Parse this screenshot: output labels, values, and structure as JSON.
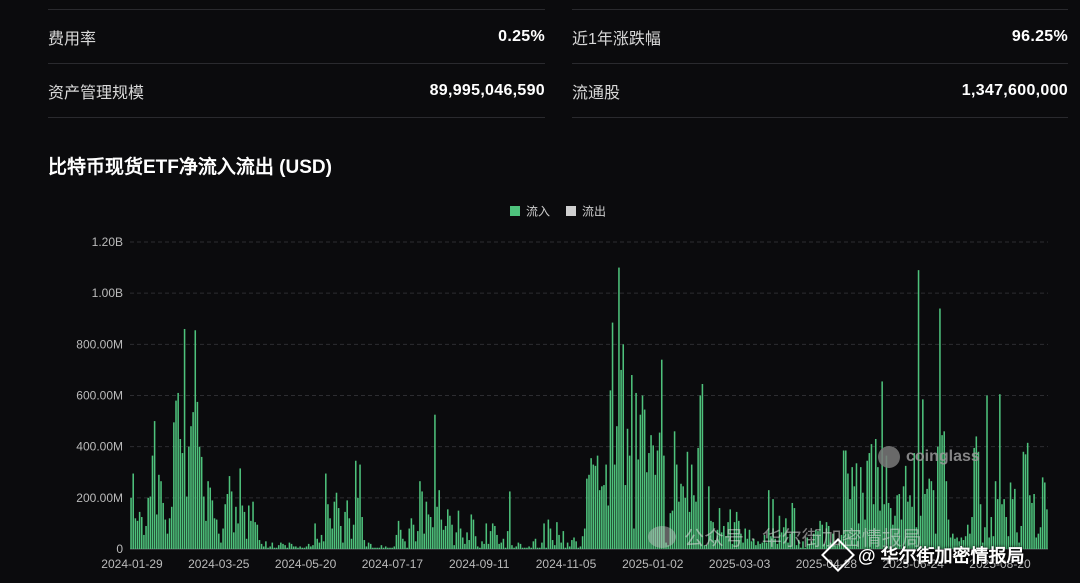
{
  "stats": [
    [
      {
        "label": "费用率",
        "value": "0.25%"
      },
      {
        "label": "近1年涨跌幅",
        "value": "96.25%"
      }
    ],
    [
      {
        "label": "资产管理规模",
        "value": "89,995,046,590"
      },
      {
        "label": "流通股",
        "value": "1,347,600,000"
      }
    ]
  ],
  "colors": {
    "inflow": "#4ec27c",
    "outflow": "#cfcfcf",
    "grid": "#2d2d31",
    "axis": "#bbbbbb"
  },
  "chart_data": {
    "type": "bar",
    "title": "比特币现货ETF净流入流出 (USD)",
    "legend": [
      {
        "name": "流入",
        "color": "#4ec27c"
      },
      {
        "name": "流出",
        "color": "#cfcfcf"
      }
    ],
    "legend_position": "top-center",
    "ylim": [
      0,
      1200000000
    ],
    "y_ticks": [
      "0",
      "200.00M",
      "400.00M",
      "600.00M",
      "800.00M",
      "1.00B",
      "1.20B"
    ],
    "x_ticks": [
      "2024-01-29",
      "2024-03-25",
      "2024-05-20",
      "2024-07-17",
      "2024-09-11",
      "2024-11-05",
      "2025-01-02",
      "2025-03-03",
      "2025-04-28",
      "2025-06-24",
      "2025-08-20"
    ],
    "grid": true,
    "series": [
      {
        "name": "流入",
        "values": [
          200,
          295,
          120,
          110,
          145,
          125,
          55,
          90,
          200,
          205,
          365,
          500,
          135,
          290,
          265,
          180,
          115,
          60,
          120,
          165,
          495,
          580,
          610,
          430,
          375,
          860,
          205,
          400,
          480,
          535,
          855,
          575,
          400,
          360,
          205,
          110,
          265,
          240,
          190,
          120,
          115,
          60,
          25,
          80,
          175,
          215,
          285,
          225,
          65,
          165,
          100,
          315,
          170,
          145,
          40,
          170,
          110,
          185,
          105,
          95,
          35,
          20,
          10,
          30,
          5,
          10,
          25,
          5,
          5,
          15,
          25,
          20,
          15,
          5,
          25,
          20,
          10,
          10,
          5,
          10,
          5,
          5,
          10,
          20,
          10,
          15,
          100,
          40,
          25,
          55,
          30,
          295,
          175,
          120,
          80,
          185,
          220,
          160,
          90,
          25,
          145,
          190,
          120,
          40,
          95,
          345,
          200,
          330,
          125,
          35,
          10,
          25,
          20,
          5,
          5,
          5,
          5,
          15,
          5,
          10,
          5,
          5,
          5,
          10,
          55,
          110,
          75,
          40,
          30,
          5,
          80,
          120,
          95,
          30,
          70,
          265,
          225,
          60,
          185,
          135,
          125,
          85,
          525,
          165,
          230,
          115,
          75,
          90,
          155,
          130,
          95,
          15,
          65,
          150,
          80,
          45,
          20,
          65,
          35,
          135,
          115,
          50,
          10,
          5,
          30,
          20,
          100,
          20,
          70,
          100,
          90,
          55,
          20,
          25,
          40,
          5,
          70,
          225,
          15,
          5,
          10,
          25,
          20,
          5,
          5,
          5,
          10,
          5,
          30,
          40,
          5,
          5,
          25,
          100,
          5,
          115,
          80,
          35,
          15,
          105,
          55,
          25,
          70,
          5,
          25,
          10,
          35,
          45,
          30,
          5,
          10,
          50,
          80,
          275,
          290,
          355,
          330,
          325,
          365,
          230,
          245,
          250,
          330,
          170,
          620,
          885,
          330,
          480,
          1100,
          700,
          800,
          250,
          470,
          365,
          680,
          80,
          610,
          350,
          525,
          600,
          545,
          300,
          375,
          445,
          405,
          290,
          385,
          455,
          740,
          365,
          25,
          15,
          140,
          150,
          460,
          330,
          185,
          255,
          245,
          200,
          380,
          145,
          330,
          210,
          185,
          395,
          600,
          645,
          15,
          15,
          245,
          110,
          105,
          35,
          75,
          160,
          65,
          90,
          50,
          105,
          155,
          20,
          105,
          145,
          110,
          60,
          25,
          80,
          40,
          75,
          30,
          40,
          15,
          30,
          20,
          25,
          55,
          25,
          230,
          50,
          195,
          40,
          20,
          130,
          65,
          85,
          120,
          25,
          60,
          180,
          160,
          15,
          35,
          5,
          30,
          5,
          45,
          20,
          30,
          60,
          75,
          70,
          110,
          95,
          20,
          105,
          90,
          25,
          60,
          15,
          15,
          35,
          55,
          385,
          385,
          295,
          195,
          320,
          245,
          335,
          100,
          320,
          220,
          115,
          345,
          375,
          410,
          175,
          430,
          320,
          150,
          655,
          175,
          365,
          180,
          160,
          95,
          130,
          210,
          215,
          115,
          245,
          325,
          185,
          210,
          165,
          375,
          85,
          1090,
          130,
          585,
          215,
          235,
          275,
          265,
          230,
          60,
          400,
          940,
          445,
          460,
          265,
          115,
          45,
          60,
          40,
          45,
          30,
          45,
          35,
          50,
          95,
          60,
          125,
          395,
          440,
          380,
          175,
          25,
          85,
          600,
          45,
          125,
          50,
          265,
          195,
          605,
          175,
          195,
          125,
          50,
          260,
          195,
          235,
          65,
          25,
          90,
          380,
          370,
          415,
          210,
          180,
          215,
          45,
          60,
          85,
          280,
          260,
          155
        ]
      }
    ]
  },
  "watermark": "coinglass",
  "wechat": "公众号 · 华尔街加密情报局",
  "source": "@ 华尔街加密情报局"
}
